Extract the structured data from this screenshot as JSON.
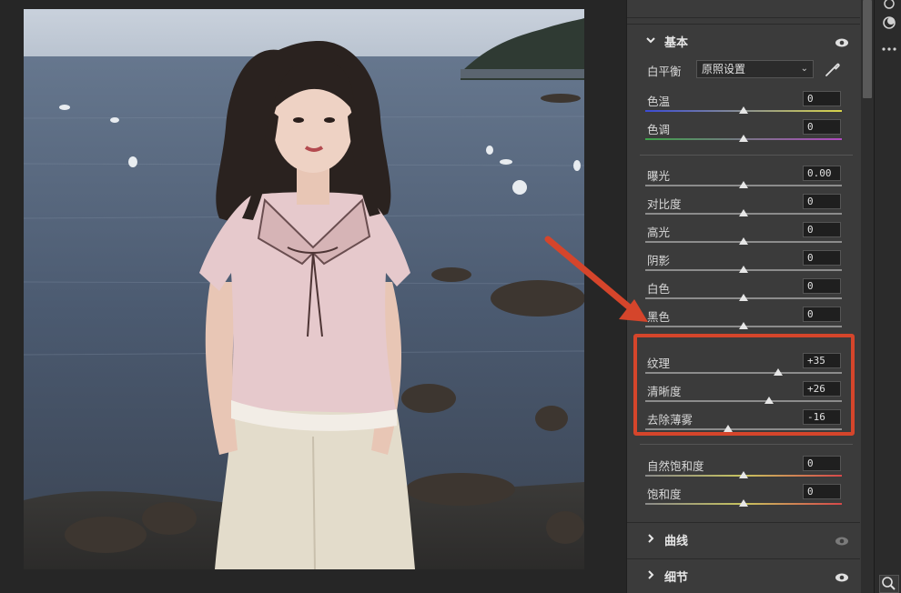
{
  "panel": {
    "basic": {
      "title": "基本",
      "white_balance": {
        "label": "白平衡",
        "selected": "原照设置"
      },
      "sliders": [
        {
          "key": "temp",
          "label": "色温",
          "value": "0",
          "level": 0.5
        },
        {
          "key": "tint",
          "label": "色调",
          "value": "0",
          "level": 0.5
        },
        {
          "key": "exposure",
          "label": "曝光",
          "value": "0.00",
          "level": 0.5
        },
        {
          "key": "contrast",
          "label": "对比度",
          "value": "0",
          "level": 0.5
        },
        {
          "key": "highlights",
          "label": "高光",
          "value": "0",
          "level": 0.5
        },
        {
          "key": "shadows",
          "label": "阴影",
          "value": "0",
          "level": 0.5
        },
        {
          "key": "whites",
          "label": "白色",
          "value": "0",
          "level": 0.5
        },
        {
          "key": "blacks",
          "label": "黑色",
          "value": "0",
          "level": 0.5
        },
        {
          "key": "texture",
          "label": "纹理",
          "value": "+35",
          "level": 0.675
        },
        {
          "key": "clarity",
          "label": "清晰度",
          "value": "+26",
          "level": 0.63
        },
        {
          "key": "dehaze",
          "label": "去除薄雾",
          "value": "-16",
          "level": 0.42
        },
        {
          "key": "vibrance",
          "label": "自然饱和度",
          "value": "0",
          "level": 0.5
        },
        {
          "key": "saturation",
          "label": "饱和度",
          "value": "0",
          "level": 0.5
        }
      ]
    },
    "curves": {
      "title": "曲线"
    },
    "detail": {
      "title": "细节"
    }
  },
  "icons": {
    "chevron_expanded": "chevron-down-icon",
    "chevron_collapsed": "chevron-right-icon",
    "visibility": "eye-icon",
    "eyedropper": "eyedropper-icon",
    "toolbar": [
      "masking-icon",
      "more-icon",
      "zoom-icon"
    ]
  },
  "colors": {
    "highlight_box": "#d5452b",
    "annotation_arrow": "#d5452b",
    "panel_bg": "#3b3b3b",
    "canvas_bg": "#262626"
  }
}
